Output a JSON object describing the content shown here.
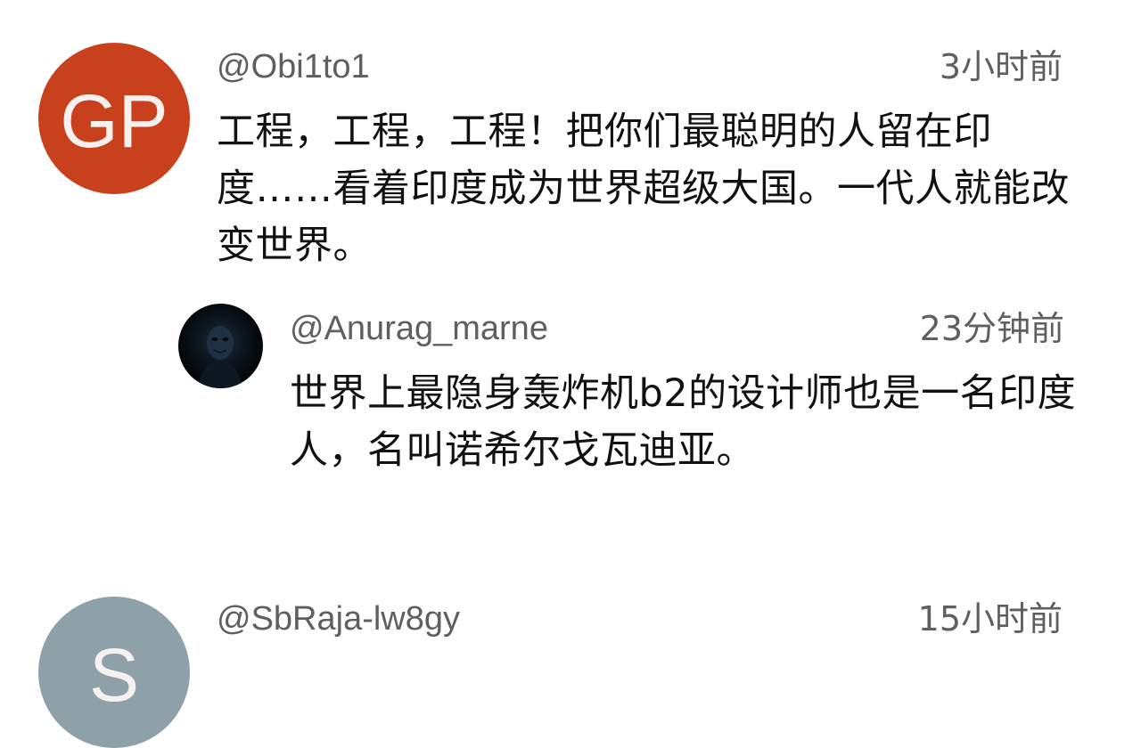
{
  "comments": [
    {
      "avatar_letters": "GP",
      "avatar_color": "#c8401c",
      "author": "@Obi1to1",
      "time": "3小时前",
      "text": "工程，工程，工程！把你们最聪明的人留在印度……看着印度成为世界超级大国。一代人就能改变世界。"
    },
    {
      "avatar_letters": "S",
      "avatar_color": "#8ea0a8",
      "author": "@SbRaja-lw8gy",
      "time": "15小时前",
      "text": ""
    }
  ],
  "reply": {
    "avatar_icon": "masked-figure-avatar",
    "author": "@Anurag_marne",
    "time": "23分钟前",
    "text": "世界上最隐身轰炸机b2的设计师也是一名印度人，名叫诺希尔戈瓦迪亚。"
  }
}
